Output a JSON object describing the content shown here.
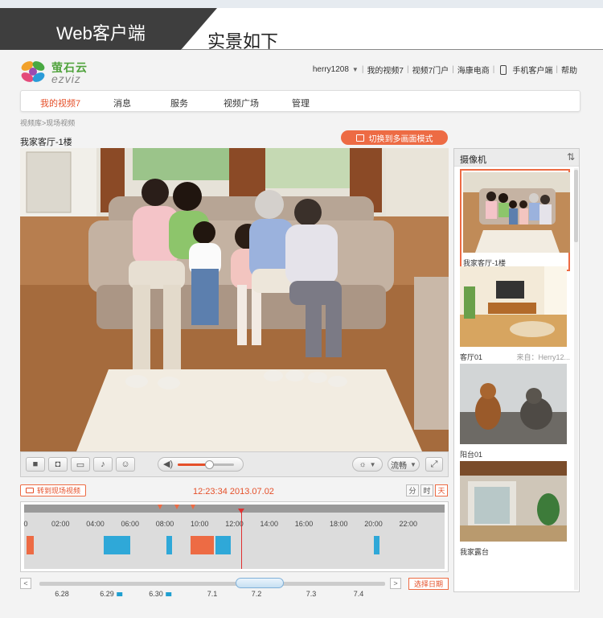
{
  "banner": {
    "title": "Web客户端",
    "subtitle": "实景如下"
  },
  "header": {
    "logo_cn": "萤石云",
    "logo_en": "ezviz",
    "user": "herry1208",
    "links": [
      "我的视频7",
      "视频7门户",
      "海康电商",
      "手机客户端",
      "帮助"
    ]
  },
  "nav": {
    "items": [
      "我的视频7",
      "消息",
      "服务",
      "视频广场",
      "管理"
    ],
    "active_index": 0
  },
  "breadcrumb": "视频库>现场视频",
  "camera_title": "我家客厅-1楼",
  "multi_view_button": "切换到多画面模式",
  "controls": {
    "icons": [
      "stop-icon",
      "snapshot-icon",
      "record-icon",
      "microphone-icon",
      "talk-icon",
      "volume-icon",
      "brightness-icon",
      "fullscreen-icon"
    ],
    "volume_level": 0.55,
    "stream_label": "流畅"
  },
  "playback": {
    "live_button": "转到现场视频",
    "timestamp": "12:23:34  2013.07.02",
    "scale_buttons": [
      "分",
      "时",
      "天"
    ],
    "active_scale": "天"
  },
  "timeline": {
    "labels": [
      "0",
      "02:00",
      "04:00",
      "06:00",
      "08:00",
      "10:00",
      "12:00",
      "14:00",
      "16:00",
      "18:00",
      "20:00",
      "22:00"
    ],
    "cursor_hour": 12.39,
    "markers_hours": [
      7.7,
      8.7,
      9.6
    ],
    "segments": [
      {
        "start": 0.05,
        "end": 0.45,
        "color": "#ed6b44"
      },
      {
        "start": 4.5,
        "end": 6.0,
        "color": "#2fa8d8"
      },
      {
        "start": 8.1,
        "end": 8.4,
        "color": "#2fa8d8"
      },
      {
        "start": 9.5,
        "end": 10.8,
        "color": "#ed6b44"
      },
      {
        "start": 10.9,
        "end": 11.8,
        "color": "#2fa8d8"
      },
      {
        "start": 20.0,
        "end": 20.35,
        "color": "#2fa8d8"
      }
    ]
  },
  "date_bar": {
    "dates": [
      "6.28",
      "6.29",
      "6.30",
      "7.1",
      "7.2",
      "7.3",
      "7.4"
    ],
    "select_button": "选择日期"
  },
  "sidebar": {
    "title": "摄像机",
    "cameras": [
      {
        "name": "我家客厅-1楼",
        "owner": "",
        "selected": true
      },
      {
        "name": "客厅01",
        "owner": "来自：Herry12...",
        "selected": false
      },
      {
        "name": "阳台01",
        "owner": "",
        "selected": false
      },
      {
        "name": "我家露台",
        "owner": "",
        "selected": false
      }
    ]
  },
  "colors": {
    "accent": "#e5502a",
    "recording_blue": "#2fa8d8"
  }
}
